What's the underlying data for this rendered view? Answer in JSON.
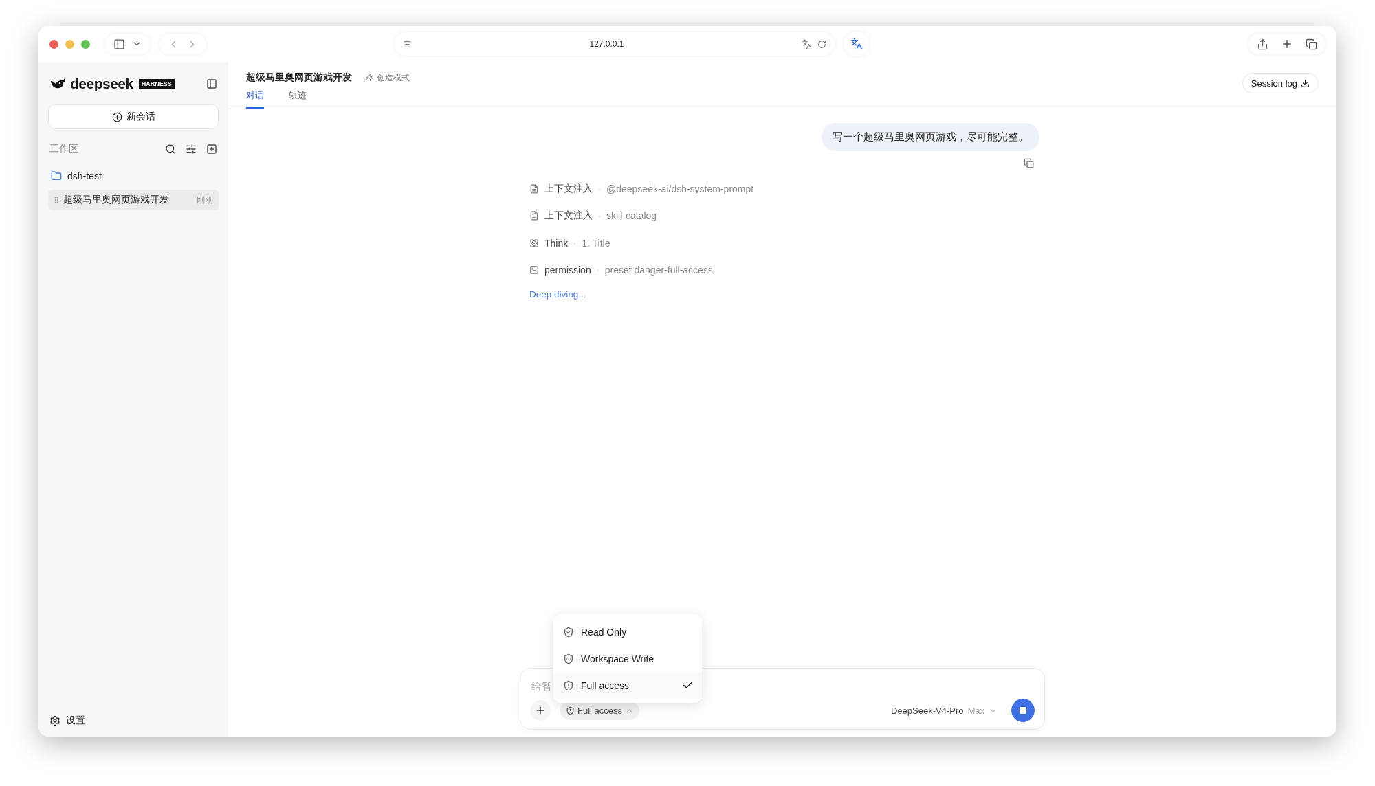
{
  "browser": {
    "address": "127.0.0.1"
  },
  "sidebar": {
    "brand": "deepseek",
    "badge": "HARNESS",
    "new_chat": "新会话",
    "section": "工作区",
    "folders": [
      {
        "name": "dsh-test",
        "children": [
          {
            "title": "超级马里奥网页游戏开发",
            "time": "刚刚",
            "selected": true
          }
        ]
      }
    ],
    "settings": "设置"
  },
  "header": {
    "title": "超级马里奥网页游戏开发",
    "mode": "创造模式",
    "tabs": [
      {
        "label": "对话",
        "selected": true
      },
      {
        "label": "轨迹",
        "selected": false
      }
    ],
    "session_log": "Session log"
  },
  "conversation": {
    "user_message": "写一个超级马里奥网页游戏，尽可能完整。",
    "events": [
      {
        "kind": "document",
        "label": "上下文注入",
        "separator": "·",
        "detail": "@deepseek-ai/dsh-system-prompt"
      },
      {
        "kind": "document",
        "label": "上下文注入",
        "separator": "·",
        "detail": "skill-catalog"
      },
      {
        "kind": "think",
        "label": "Think",
        "separator": "·",
        "detail": "1. Title"
      },
      {
        "kind": "terminal",
        "label": "permission",
        "separator": "·",
        "detail": "preset danger-full-access"
      }
    ],
    "status": "Deep diving..."
  },
  "composer": {
    "placeholder": "给智",
    "permission": "Full access",
    "model": "DeepSeek-V4-Pro",
    "effort": "Max"
  },
  "permission_menu": [
    {
      "kind": "read",
      "label": "Read Only",
      "selected": false
    },
    {
      "kind": "write",
      "label": "Workspace Write",
      "selected": false
    },
    {
      "kind": "full",
      "label": "Full access",
      "selected": true
    }
  ]
}
